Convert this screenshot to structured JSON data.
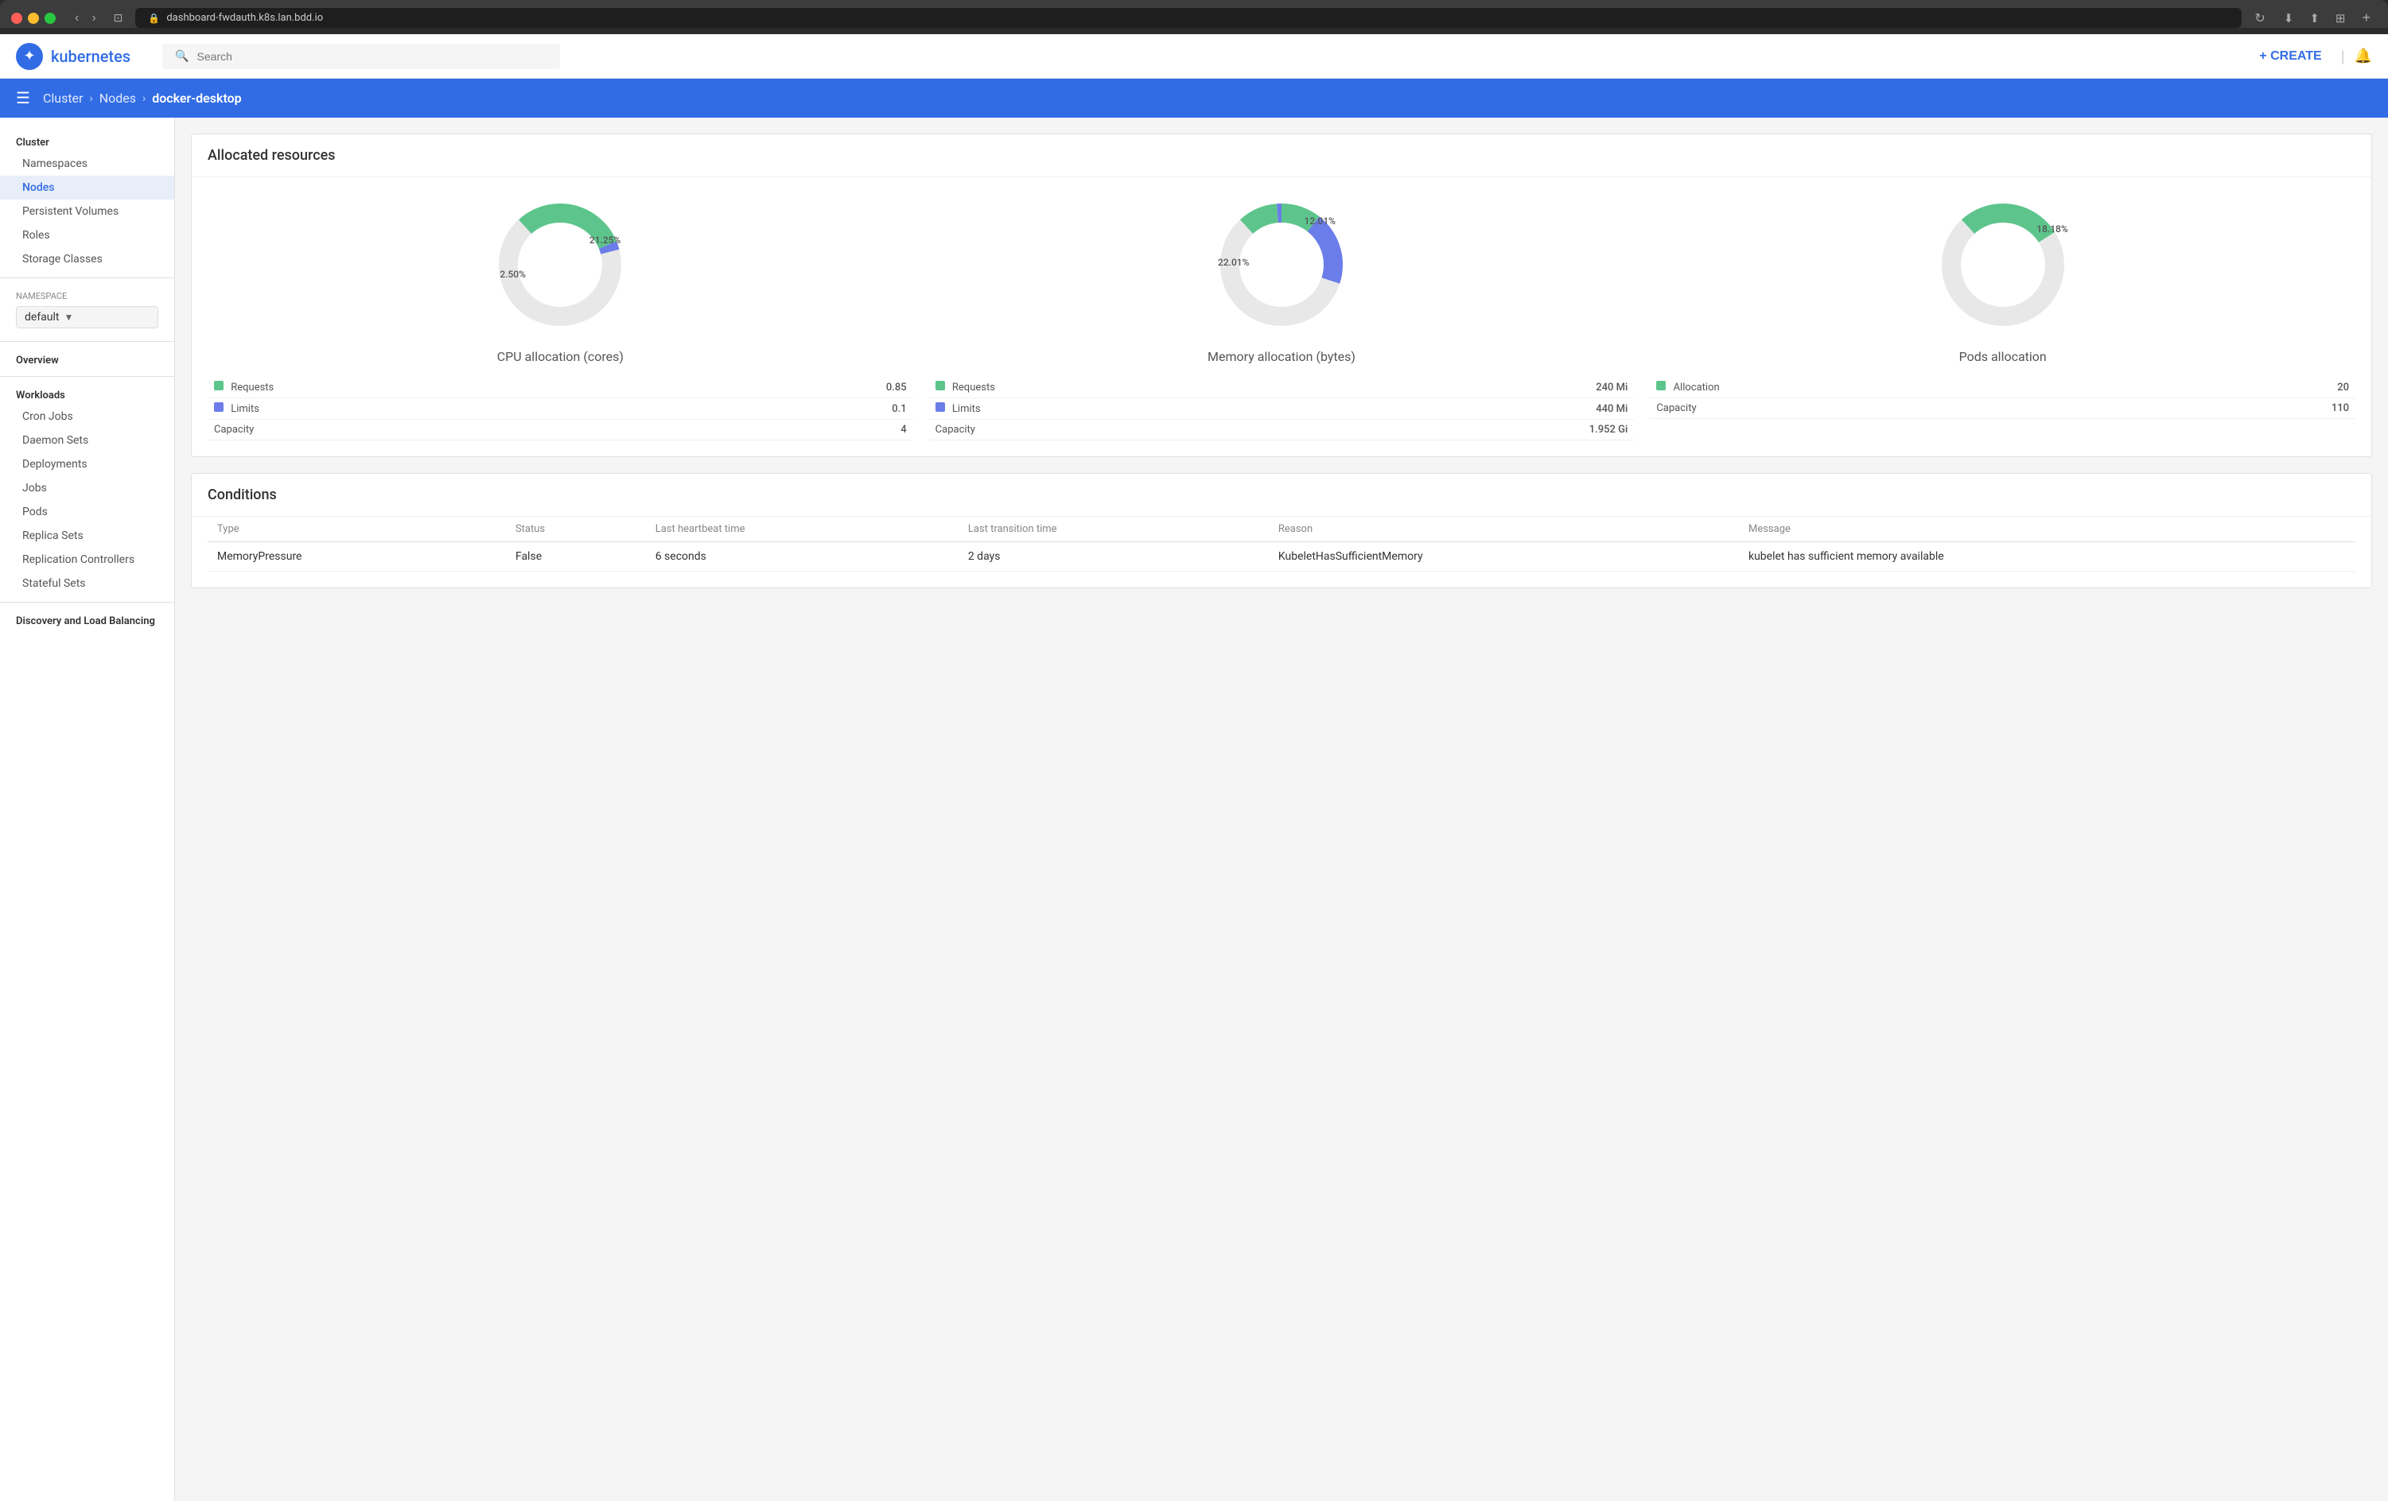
{
  "browser": {
    "url": "dashboard-fwdauth.k8s.lan.bdd.io",
    "url_display": "dashboard-fwdauth.k8s.lan.bdd.io"
  },
  "app": {
    "title": "kubernetes"
  },
  "search": {
    "placeholder": "Search"
  },
  "nav": {
    "create_label": "+ CREATE"
  },
  "breadcrumb": {
    "cluster": "Cluster",
    "nodes": "Nodes",
    "current": "docker-desktop"
  },
  "sidebar": {
    "cluster_label": "Cluster",
    "items_cluster": [
      {
        "id": "namespaces",
        "label": "Namespaces"
      },
      {
        "id": "nodes",
        "label": "Nodes"
      },
      {
        "id": "persistent-volumes",
        "label": "Persistent Volumes"
      },
      {
        "id": "roles",
        "label": "Roles"
      },
      {
        "id": "storage-classes",
        "label": "Storage Classes"
      }
    ],
    "namespace_label": "Namespace",
    "namespace_value": "default",
    "overview_label": "Overview",
    "workloads_label": "Workloads",
    "items_workloads": [
      {
        "id": "cron-jobs",
        "label": "Cron Jobs"
      },
      {
        "id": "daemon-sets",
        "label": "Daemon Sets"
      },
      {
        "id": "deployments",
        "label": "Deployments"
      },
      {
        "id": "jobs",
        "label": "Jobs"
      },
      {
        "id": "pods",
        "label": "Pods"
      },
      {
        "id": "replica-sets",
        "label": "Replica Sets"
      },
      {
        "id": "replication-controllers",
        "label": "Replication Controllers"
      },
      {
        "id": "stateful-sets",
        "label": "Stateful Sets"
      }
    ],
    "discovery_label": "Discovery and Load Balancing"
  },
  "allocated_resources": {
    "title": "Allocated resources",
    "cpu": {
      "title": "CPU allocation (cores)",
      "requests_label": "Requests",
      "requests_value": "0.85",
      "limits_label": "Limits",
      "limits_value": "0.1",
      "capacity_label": "Capacity",
      "capacity_value": "4",
      "percent_green": "21.25%",
      "percent_blue": "2.50%",
      "green_deg": 76.5,
      "blue_deg": 9
    },
    "memory": {
      "title": "Memory allocation (bytes)",
      "requests_label": "Requests",
      "requests_value": "240 Mi",
      "limits_label": "Limits",
      "limits_value": "440 Mi",
      "capacity_label": "Capacity",
      "capacity_value": "1.952 Gi",
      "percent_green": "12.01%",
      "percent_blue": "22.01%",
      "green_deg": 43.2,
      "blue_deg": 79.2
    },
    "pods": {
      "title": "Pods allocation",
      "allocation_label": "Allocation",
      "allocation_value": "20",
      "capacity_label": "Capacity",
      "capacity_value": "110",
      "percent_green": "18.18%",
      "green_deg": 65.5
    }
  },
  "conditions": {
    "title": "Conditions",
    "columns": [
      "Type",
      "Status",
      "Last heartbeat time",
      "Last transition time",
      "Reason",
      "Message"
    ],
    "rows": [
      {
        "type": "MemoryPressure",
        "status": "False",
        "heartbeat": "6 seconds",
        "transition": "2 days",
        "reason": "KubeletHasSufficientMemory",
        "message": "kubelet has sufficient memory available"
      }
    ]
  }
}
